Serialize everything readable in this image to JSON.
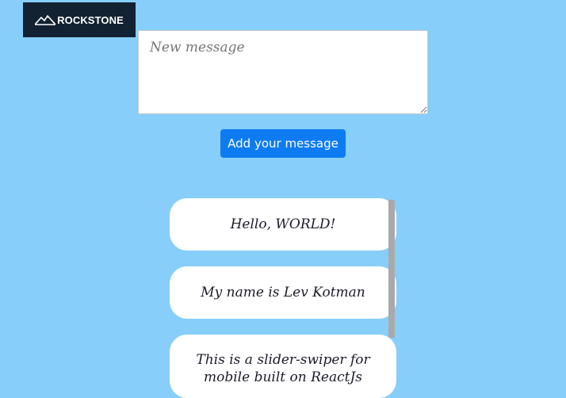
{
  "logo": {
    "text": "ROCKSTONE",
    "icon": "mountain-icon"
  },
  "composer": {
    "placeholder": "New message",
    "value": ""
  },
  "add_button": {
    "label": "Add your message"
  },
  "messages": [
    {
      "text": "Hello, WORLD!"
    },
    {
      "text": "My name is Lev Kotman"
    },
    {
      "text": "This is a slider-swiper for mobile built on ReactJs"
    }
  ],
  "colors": {
    "background": "#87cefa",
    "logo_background": "#122232",
    "button": "#0d7cf2",
    "card": "#ffffff"
  }
}
